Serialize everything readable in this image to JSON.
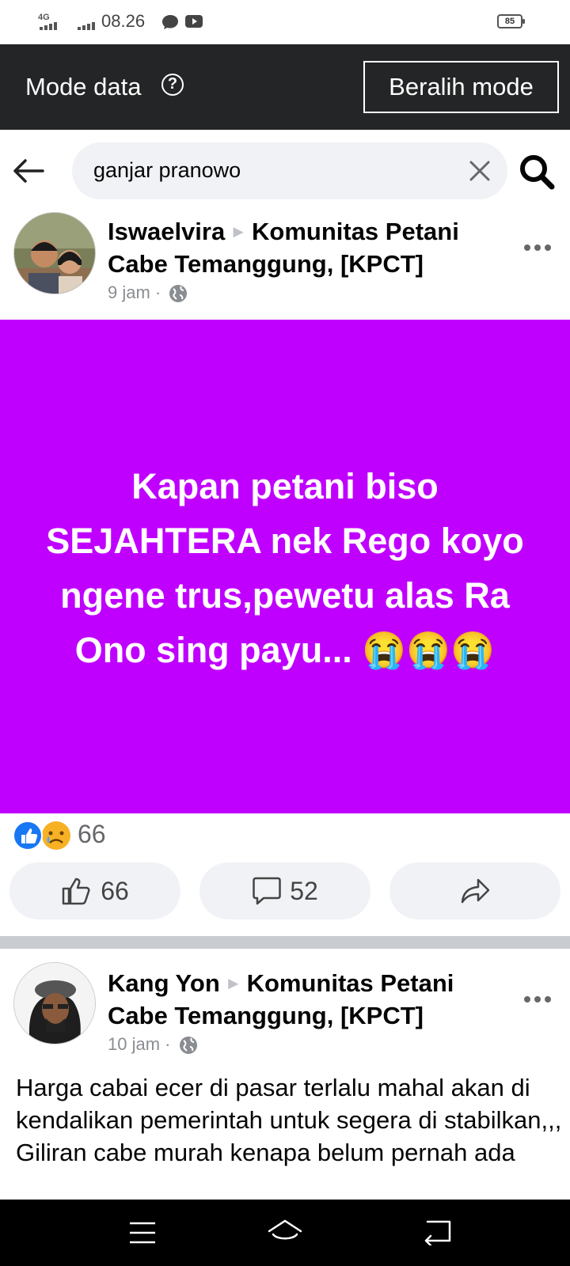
{
  "status_bar": {
    "network": "4G",
    "time": "08.26",
    "battery": "85"
  },
  "data_mode": {
    "title": "Mode data",
    "help_icon": "question-circle-icon",
    "switch_button": "Beralih mode"
  },
  "search": {
    "query": "ganjar pranowo"
  },
  "posts": [
    {
      "author": "Iswaelvira",
      "group": "Komunitas Petani Cabe Temanggung, [KPCT]",
      "time": "9 jam",
      "body": "Kapan petani biso SEJAHTERA nek Rego koyo ngene trus,pewetu alas Ra Ono sing payu... 😭😭😭",
      "background_color": "#c000ff",
      "reaction_count": "66",
      "like_count": "66",
      "comment_count": "52"
    },
    {
      "author": "Kang Yon",
      "group": "Komunitas Petani Cabe Temanggung, [KPCT]",
      "time": "10 jam",
      "body_lines": [
        "Harga cabai ecer di pasar terlalu mahal akan di kendalikan pemerintah untuk segera di stabilkan,,,",
        "Giliran cabe murah kenapa belum pernah ada"
      ]
    }
  ],
  "colors": {
    "mode_bar": "#242526",
    "search_bg": "#f0f2f5",
    "like_blue": "#1877f2",
    "separator": "#c9ccd1"
  }
}
